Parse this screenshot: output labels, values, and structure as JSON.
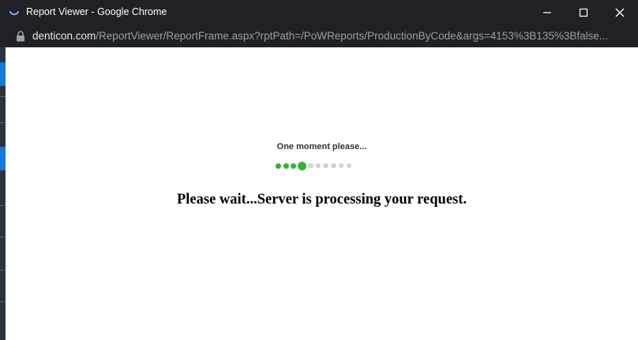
{
  "window": {
    "title": "Report Viewer - Google Chrome"
  },
  "address_bar": {
    "domain": "denticon.com",
    "path": "/ReportViewer/ReportFrame.aspx?rptPath=/PoWReports/ProductionByCode&args=4153%3B135%3Bfalse..."
  },
  "loader": {
    "label": "One moment please...",
    "total_dots": 10,
    "active_dots": 4,
    "active_color": "#2db52d",
    "inactive_color": "#d4d4d4"
  },
  "message": "Please wait...Server is processing your request."
}
